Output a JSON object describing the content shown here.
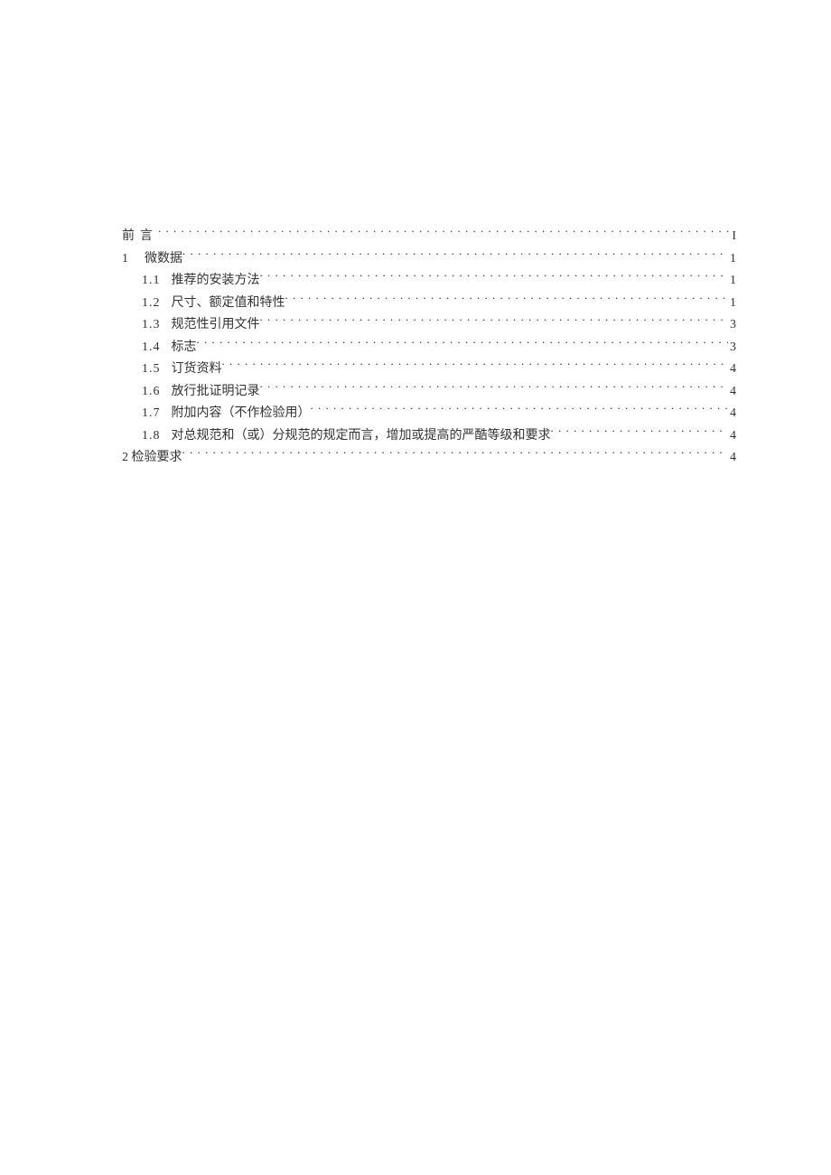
{
  "toc": {
    "entries": [
      {
        "level": 1,
        "number": "",
        "title": "前言",
        "page": "I",
        "numClass": "",
        "gapClass": "",
        "preSpace": true
      },
      {
        "level": 1,
        "number": "1",
        "title": "微数据",
        "page": "1",
        "numClass": "",
        "gapClass": "gap-a",
        "preSpace": false
      },
      {
        "level": 2,
        "number": "1.1",
        "title": "推荐的安装方法",
        "page": "1",
        "numClass": "num",
        "gapClass": "gap-b",
        "preSpace": false
      },
      {
        "level": 2,
        "number": "1.2",
        "title": "尺寸、额定值和特性",
        "page": "1",
        "numClass": "num",
        "gapClass": "gap-b",
        "preSpace": false
      },
      {
        "level": 2,
        "number": "1.3",
        "title": "规范性引用文件",
        "page": "3",
        "numClass": "num",
        "gapClass": "gap-b",
        "preSpace": false
      },
      {
        "level": 2,
        "number": "1.4",
        "title": "标志",
        "page": "3",
        "numClass": "num",
        "gapClass": "gap-b",
        "preSpace": false
      },
      {
        "level": 2,
        "number": "1.5",
        "title": "订货资料",
        "page": "4",
        "numClass": "num",
        "gapClass": "gap-b",
        "preSpace": false
      },
      {
        "level": 2,
        "number": "1.6",
        "title": "放行批证明记录",
        "page": "4",
        "numClass": "num",
        "gapClass": "gap-b",
        "preSpace": false
      },
      {
        "level": 2,
        "number": "1.7",
        "title": "附加内容（不作检验用）",
        "page": "4",
        "numClass": "num",
        "gapClass": "gap-b",
        "preSpace": false
      },
      {
        "level": 2,
        "number": "1.8",
        "title": "对总规范和（或）分规范的规定而言，增加或提高的严酷等级和要求",
        "page": "4",
        "numClass": "num",
        "gapClass": "gap-b",
        "preSpace": false
      },
      {
        "level": 1,
        "number": "2",
        "title": "检验要求",
        "page": "4",
        "numClass": "",
        "gapClass": "",
        "preSpace": false,
        "joinNumber": true
      }
    ]
  }
}
